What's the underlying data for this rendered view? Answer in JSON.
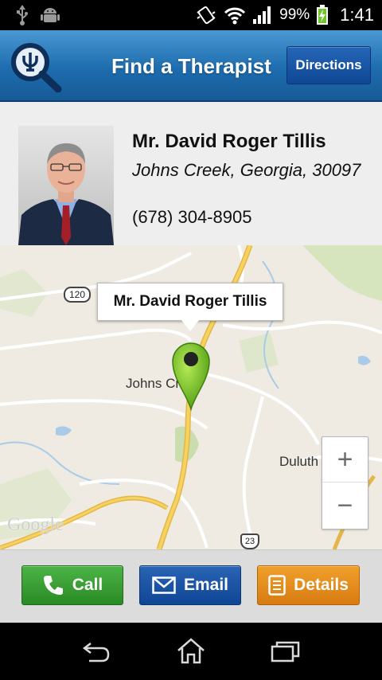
{
  "status_bar": {
    "battery_percent": "99%",
    "time": "1:41",
    "icons": [
      "usb-icon",
      "android-icon",
      "vibrate-icon",
      "wifi-icon",
      "signal-icon",
      "battery-charging-icon"
    ]
  },
  "header": {
    "title": "Find a Therapist",
    "logo_icon": "psi-magnifier-icon",
    "directions_label": "Directions"
  },
  "therapist": {
    "name": "Mr. David Roger Tillis",
    "location": "Johns Creek, Georgia, 30097",
    "phone": "(678) 304-8905"
  },
  "map": {
    "marker_label": "Mr. David Roger Tillis",
    "towns": [
      "Johns Creek",
      "Duluth"
    ],
    "route_shields": [
      "120",
      "23"
    ],
    "attribution": "Google",
    "zoom_in_label": "+",
    "zoom_out_label": "−"
  },
  "actions": {
    "call_label": "Call",
    "email_label": "Email",
    "details_label": "Details",
    "colors": {
      "call": "#3a9f33",
      "email": "#1a55a6",
      "details": "#e48d1d"
    }
  },
  "nav": {
    "icons": [
      "back-icon",
      "home-icon",
      "recent-apps-icon"
    ]
  },
  "colors": {
    "header": "#1d6cae",
    "profile_bg": "#eeeeee",
    "map_bg": "#efebe2",
    "pin": "#6fbf25"
  }
}
